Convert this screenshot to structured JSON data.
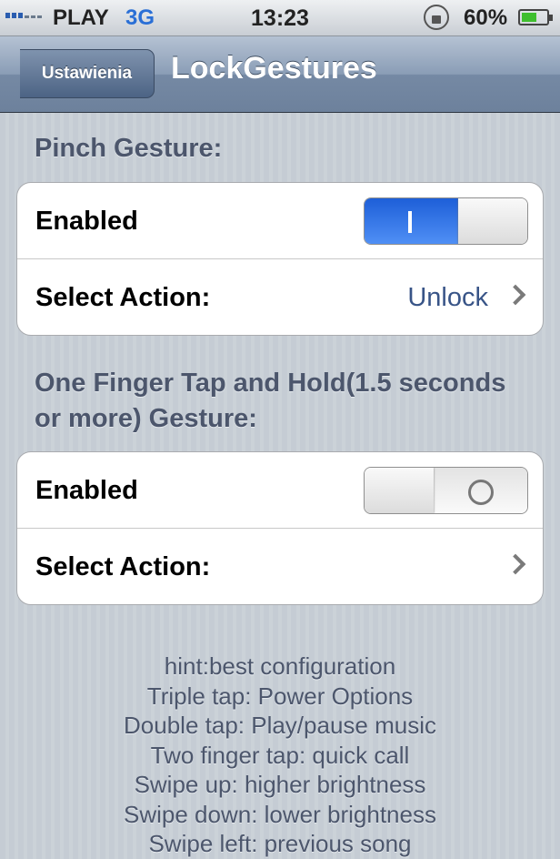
{
  "status_bar": {
    "carrier": "PLAY",
    "network": "3G",
    "time": "13:23",
    "battery_percent": "60%",
    "battery_level": 0.6,
    "icons": [
      "signal-icon",
      "rotation-lock-icon",
      "battery-icon"
    ]
  },
  "nav": {
    "back_label": "Ustawienia",
    "title": "LockGestures"
  },
  "sections": [
    {
      "header": "Pinch Gesture:",
      "enabled_label": "Enabled",
      "enabled": true,
      "select_label": "Select Action:",
      "select_value": "Unlock"
    },
    {
      "header": "One Finger Tap and Hold(1.5 seconds or more) Gesture:",
      "enabled_label": "Enabled",
      "enabled": false,
      "select_label": "Select Action:",
      "select_value": ""
    }
  ],
  "hints": [
    "hint:best configuration",
    "Triple tap: Power Options",
    "Double tap: Play/pause music",
    "Two finger tap: quick call",
    "Swipe up: higher brightness",
    "Swipe down: lower brightness",
    "Swipe left: previous song"
  ],
  "colors": {
    "switch_on": "#2a6fe0",
    "value_text": "#385487",
    "header_text": "#4c566c"
  }
}
